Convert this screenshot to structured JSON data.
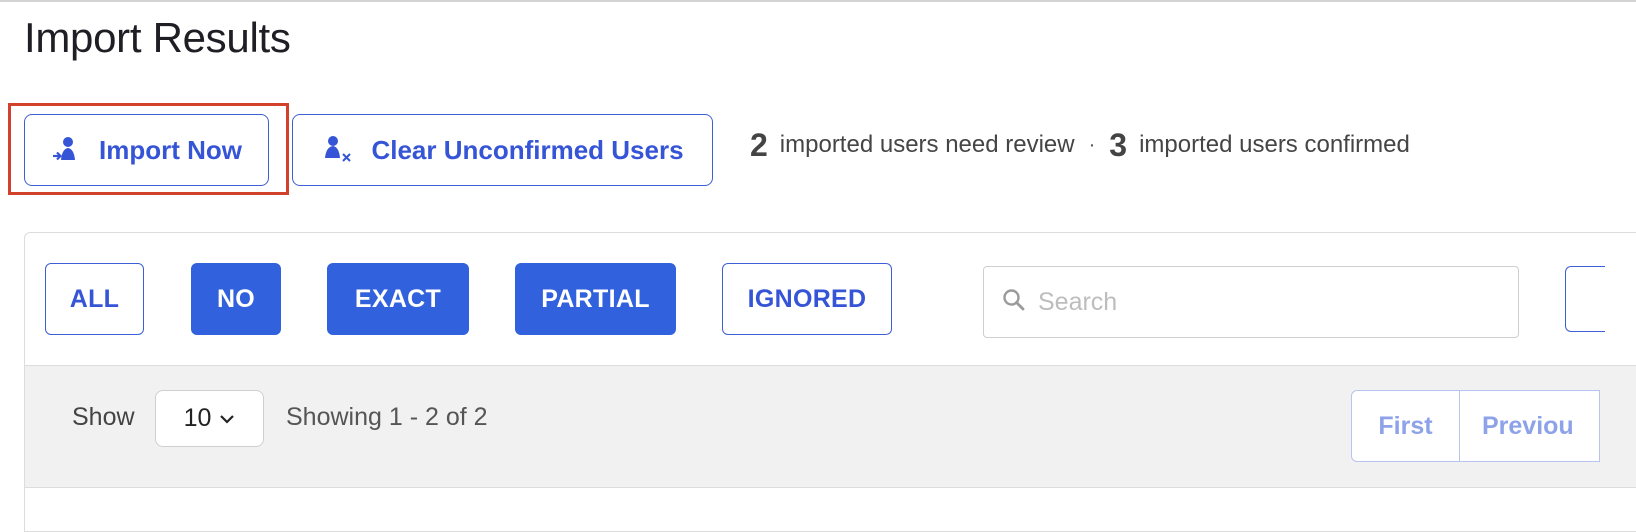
{
  "page": {
    "title": "Import Results"
  },
  "actions": {
    "import_label": "Import Now",
    "clear_label": "Clear Unconfirmed Users",
    "import_icon": "user-import-icon",
    "clear_icon": "user-remove-icon"
  },
  "stats": {
    "review_count": "2",
    "review_text": "imported users need review",
    "separator": "·",
    "confirmed_count": "3",
    "confirmed_text": "imported users confirmed"
  },
  "filters": {
    "all": "ALL",
    "no": "NO",
    "exact": "EXACT",
    "partial": "PARTIAL",
    "ignored": "IGNORED",
    "active": [
      "NO",
      "EXACT",
      "PARTIAL"
    ]
  },
  "search": {
    "placeholder": "Search",
    "value": "",
    "icon": "search-icon"
  },
  "paging": {
    "show_label": "Show",
    "page_size": "10",
    "showing_text": "Showing 1 - 2 of 2",
    "first_label": "First",
    "previous_label": "Previou"
  },
  "colors": {
    "accent": "#3554d6",
    "filled_chip": "#3161dc",
    "highlight": "#d2412c",
    "pager_text": "#8ea2ea"
  }
}
